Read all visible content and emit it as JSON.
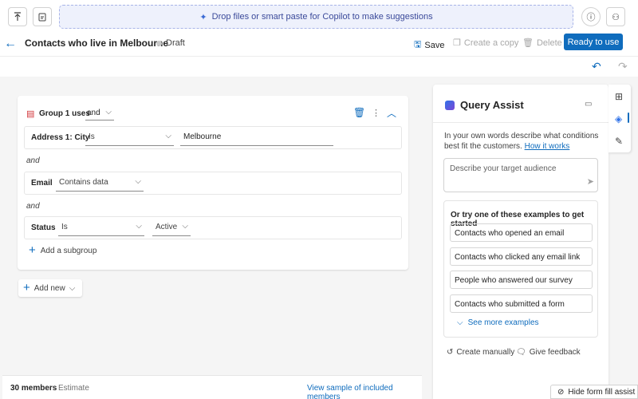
{
  "dropzone": {
    "text": "Drop files or smart paste for Copilot to make suggestions"
  },
  "header": {
    "title": "Contacts who live in Melbourne",
    "status": "Draft",
    "save": "Save",
    "create_copy": "Create a copy",
    "delete": "Delete",
    "ready": "Ready to use"
  },
  "group": {
    "label": "Group 1 uses",
    "operator": "and",
    "rows": [
      {
        "field": "Address 1: City",
        "op": "Is",
        "value": "Melbourne"
      },
      {
        "field": "Email",
        "op": "Contains data",
        "value": ""
      },
      {
        "field": "Status",
        "op": "Is",
        "value": "Active"
      }
    ],
    "joiner": "and",
    "add_subgroup": "Add a subgroup"
  },
  "add_new": "Add new",
  "footer": {
    "members": "30 members",
    "estimate": "Estimate",
    "sample_link": "View sample of included members"
  },
  "query_assist": {
    "title": "Query Assist",
    "description": "In your own words describe what conditions best fit the customers.",
    "how_link": "How it works",
    "placeholder": "Describe your target audience",
    "examples_heading": "Or try one of these examples to get started",
    "examples": [
      "Contacts who opened an email",
      "Contacts who clicked any email link",
      "People who answered our survey",
      "Contacts who submitted a form"
    ],
    "see_more": "See more examples",
    "create_manually": "Create manually",
    "give_feedback": "Give feedback"
  },
  "hide_form": "Hide form fill assist",
  "colors": {
    "accent": "#0f6cbd"
  }
}
